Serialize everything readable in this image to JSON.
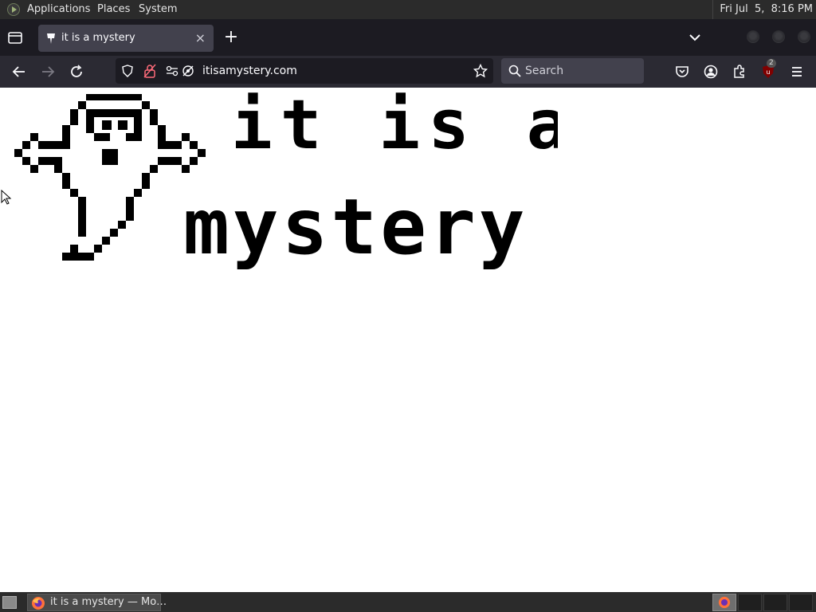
{
  "top_panel": {
    "distro_icon": "distro-logo-icon",
    "menus": [
      "Applications",
      "Places",
      "System"
    ],
    "clock": "Fri Jul  5,  8:16 PM"
  },
  "browser": {
    "tab": {
      "title": "it is a mystery",
      "favicon": "ghost-favicon-icon",
      "close_glyph": "×"
    },
    "new_tab_glyph": "+",
    "url": "itisamystery.com",
    "search_placeholder": "Search",
    "ublock_badge": "2"
  },
  "page": {
    "line1": "it is a",
    "line2": "mystery",
    "art": "pixel-ghost-drawing"
  },
  "taskbar": {
    "task_label": "it is a mystery — Mo…"
  },
  "colors": {
    "panel_bg": "#2b2b2b",
    "tabbar_bg": "#1c1b22",
    "toolbar_bg": "#2b2a33",
    "urlbar_bg": "#1c1b22",
    "art_ink": "#000000",
    "page_bg": "#ffffff"
  }
}
